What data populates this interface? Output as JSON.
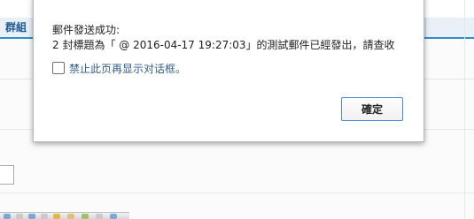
{
  "background": {
    "tab_label": "群組"
  },
  "dialog": {
    "title": "郵件發送成功:",
    "message": "2 封標題為「 @ 2016-04-17 19:27:03」的測試郵件已經發出，請查收",
    "suppress_checkbox": {
      "label": "禁止此页再显示对话框。",
      "checked": false
    },
    "ok_label": "確定"
  },
  "colors": {
    "accent_blue": "#2f8ec8",
    "button_border": "#4a90d9",
    "checkbox_label": "#335e8c",
    "tab_text": "#1e5a96"
  }
}
